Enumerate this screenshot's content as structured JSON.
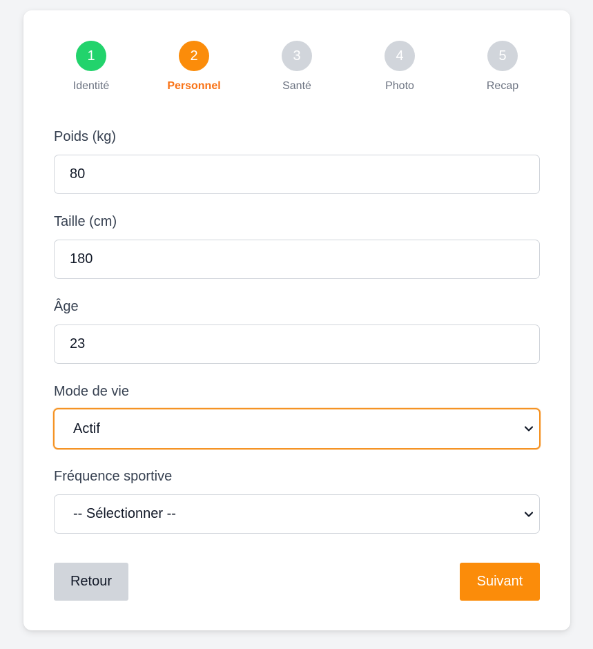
{
  "stepper": {
    "steps": [
      {
        "number": "1",
        "label": "Identité",
        "state": "done"
      },
      {
        "number": "2",
        "label": "Personnel",
        "state": "active"
      },
      {
        "number": "3",
        "label": "Santé",
        "state": "pending"
      },
      {
        "number": "4",
        "label": "Photo",
        "state": "pending"
      },
      {
        "number": "5",
        "label": "Recap",
        "state": "pending"
      }
    ]
  },
  "form": {
    "weight": {
      "label": "Poids (kg)",
      "value": "80"
    },
    "height": {
      "label": "Taille (cm)",
      "value": "180"
    },
    "age": {
      "label": "Âge",
      "value": "23"
    },
    "lifestyle": {
      "label": "Mode de vie",
      "selected": "Actif"
    },
    "sport_frequency": {
      "label": "Fréquence sportive",
      "selected": "-- Sélectionner --"
    }
  },
  "actions": {
    "back_label": "Retour",
    "next_label": "Suivant"
  },
  "colors": {
    "accent": "#fb8c0a",
    "done": "#22d36c",
    "pending": "#d1d5db",
    "focus_border": "#f59324"
  },
  "icons": {
    "select_chevron": "chevron-down-icon"
  }
}
